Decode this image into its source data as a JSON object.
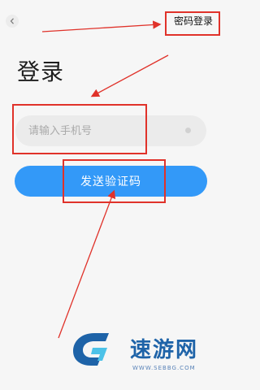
{
  "header": {
    "back_icon": "chevron-left-icon",
    "password_login_label": "密码登录"
  },
  "title": "登录",
  "phone_input": {
    "placeholder": "请输入手机号",
    "value": "",
    "clear_icon": "clear-dot-icon"
  },
  "send_button_label": "发送验证码",
  "watermark": {
    "name": "速游网",
    "url": "WWW.SEBBG.COM"
  },
  "colors": {
    "accent": "#3399f8",
    "annotation": "#e0322a",
    "background": "#f6f6f6",
    "input_bg": "#ebebeb"
  }
}
